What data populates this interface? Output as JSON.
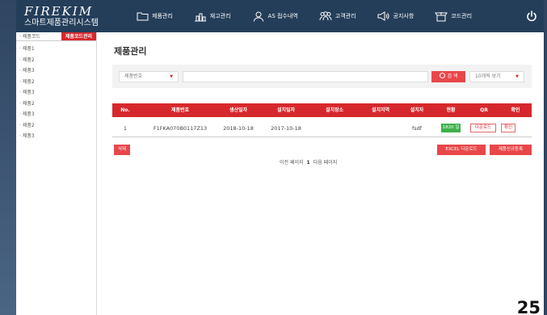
{
  "brand": {
    "title": "FIREKIM",
    "subtitle": "스마트제품관리시스템"
  },
  "nav": [
    {
      "label": "제품관리",
      "icon": "folder-icon"
    },
    {
      "label": "재고관리",
      "icon": "inventory-icon"
    },
    {
      "label": "AS 접수내역",
      "icon": "user-icon"
    },
    {
      "label": "고객관리",
      "icon": "customers-icon"
    },
    {
      "label": "공지사항",
      "icon": "megaphone-icon"
    },
    {
      "label": "코드관리",
      "icon": "code-icon"
    }
  ],
  "sidebar": {
    "tabs": [
      "· 제품코드",
      "제품코드관리"
    ],
    "items": [
      "· 제품1",
      "· 제품2",
      "· 제품3",
      "· 제품2",
      "· 제품3",
      "· 제품2",
      "· 제품3",
      "· 제품2",
      "· 제품3"
    ]
  },
  "page": {
    "title": "제품관리",
    "page_number": "25"
  },
  "search": {
    "field": "제품번호",
    "query": "",
    "button": "검 색",
    "page_size": "10개씩 보기"
  },
  "table": {
    "headers": [
      "No.",
      "제품번호",
      "생산일자",
      "설치일자",
      "설치장소",
      "설치지역",
      "설치자",
      "현황",
      "QR",
      "확인"
    ],
    "rows": [
      {
        "no": "1",
        "product_no": "F1FKA070B0117Z13",
        "production_date": "2018-10-18",
        "install_date": "2017-10-18",
        "place": "",
        "region": "",
        "installer": "fsdf",
        "status": "1820 일",
        "qr": "다운로드",
        "confirm": "확인"
      }
    ]
  },
  "actions": {
    "delete": "삭제",
    "excel": "EXCEL 다운로드",
    "register": "제품신규등록"
  },
  "pager": {
    "prev": "이전 페이지",
    "current": "1",
    "next": "다음 페이지"
  },
  "colors": {
    "accent": "#d6282c",
    "header": "#243e5a",
    "status": "#3cb14a"
  }
}
